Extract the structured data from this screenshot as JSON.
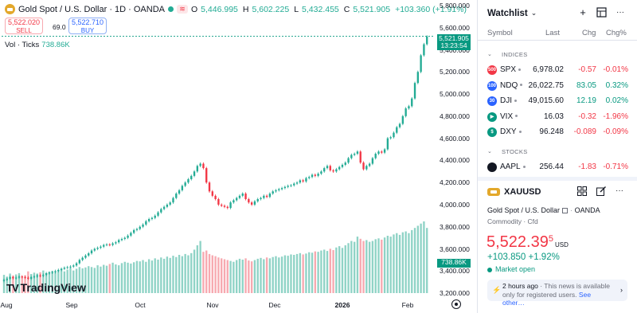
{
  "chart_header": {
    "title": "Gold Spot / U.S. Dollar · 1D · OANDA",
    "wave_glyph": "≋",
    "open_label": "O",
    "open": "5,446.995",
    "high_label": "H",
    "high": "5,602.225",
    "low_label": "L",
    "low": "5,432.455",
    "close_label": "C",
    "close": "5,521.905",
    "change": "+103.360 (+1.91%)"
  },
  "trade": {
    "sell_price": "5,522.020",
    "sell_label": "SELL",
    "spread": "69.0",
    "buy_price": "5,522.710",
    "buy_label": "BUY"
  },
  "volume_legend": {
    "label": "Vol · Ticks",
    "value": "738.86K"
  },
  "price_tag": {
    "price": "5,521.905",
    "countdown": "13:23:54"
  },
  "volume_tag": "738.86K",
  "brand": "TradingView",
  "y_ticks": [
    "5,800.000",
    "5,600.000",
    "5,400.000",
    "5,200.000",
    "5,000.000",
    "4,800.000",
    "4,600.000",
    "4,400.000",
    "4,200.000",
    "4,000.000",
    "3,800.000",
    "3,600.000",
    "3,400.000",
    "3,200.000"
  ],
  "x_ticks": [
    "Aug",
    "Sep",
    "Oct",
    "Nov",
    "Dec",
    "2026",
    "Feb"
  ],
  "colors": {
    "up": "#22ab94",
    "down": "#f23645",
    "vol_up": "#8fd3c6",
    "vol_down": "#f7a9b0",
    "accent": "#2962ff"
  },
  "chart_data": {
    "type": "candlestick",
    "title": "Gold Spot / U.S. Dollar",
    "ylim": [
      3150,
      5850
    ],
    "x_ticks": [
      "Aug",
      "Sep",
      "Oct",
      "Nov",
      "Dec",
      "2026",
      "Feb"
    ],
    "last_close": 5521.905,
    "volume_last": "738.86K",
    "candles_close": [
      3320,
      3330,
      3345,
      3335,
      3340,
      3350,
      3345,
      3340,
      3330,
      3345,
      3350,
      3360,
      3355,
      3365,
      3380,
      3385,
      3390,
      3400,
      3410,
      3420,
      3430,
      3435,
      3440,
      3450,
      3470,
      3500,
      3520,
      3540,
      3560,
      3585,
      3600,
      3610,
      3620,
      3635,
      3640,
      3635,
      3650,
      3660,
      3680,
      3690,
      3700,
      3720,
      3745,
      3770,
      3780,
      3800,
      3820,
      3850,
      3870,
      3880,
      3900,
      3930,
      3960,
      3980,
      4000,
      4020,
      4060,
      4100,
      4130,
      4170,
      4200,
      4230,
      4260,
      4300,
      4350,
      4370,
      4330,
      4200,
      4120,
      4080,
      4050,
      4000,
      3990,
      3980,
      3970,
      4020,
      4040,
      4060,
      4080,
      4100,
      4050,
      4020,
      4000,
      4030,
      4050,
      4060,
      4080,
      4070,
      4100,
      4120,
      4130,
      4140,
      4150,
      4160,
      4170,
      4175,
      4190,
      4200,
      4220,
      4210,
      4240,
      4250,
      4270,
      4260,
      4280,
      4300,
      4330,
      4350,
      4310,
      4300,
      4320,
      4340,
      4360,
      4380,
      4420,
      4450,
      4460,
      4480,
      4380,
      4320,
      4350,
      4370,
      4420,
      4460,
      4480,
      4470,
      4500,
      4600,
      4610,
      4650,
      4700,
      4730,
      4800,
      4870,
      4890,
      4960,
      5100,
      5200,
      5350,
      5450,
      5520
    ],
    "volume": [
      420,
      380,
      450,
      400,
      430,
      460,
      390,
      410,
      500,
      440,
      470,
      450,
      480,
      520,
      460,
      490,
      510,
      480,
      530,
      560,
      500,
      540,
      580,
      520,
      560,
      600,
      570,
      590,
      620,
      600,
      580,
      640,
      610,
      650,
      630,
      670,
      700,
      660,
      640,
      690,
      720,
      700,
      680,
      710,
      740,
      730,
      760,
      720,
      780,
      750,
      800,
      770,
      820,
      790,
      840,
      810,
      860,
      830,
      880,
      850,
      900,
      870,
      920,
      1000,
      1100,
      1200,
      950,
      980,
      900,
      870,
      850,
      820,
      800,
      780,
      760,
      740,
      720,
      760,
      790,
      770,
      800,
      750,
      730,
      760,
      790,
      810,
      780,
      820,
      800,
      830,
      850,
      820,
      840,
      870,
      860,
      890,
      880,
      900,
      920,
      890,
      910,
      940,
      930,
      960,
      950,
      980,
      1000,
      970,
      1020,
      990,
      1050,
      1080,
      1040,
      1100,
      1150,
      1200,
      1180,
      1300,
      1250,
      1200,
      1220,
      1180,
      1200,
      1240,
      1260,
      1230,
      1280,
      1320,
      1300,
      1350,
      1380,
      1340,
      1400,
      1420,
      1380,
      1450,
      1500,
      1550,
      1600,
      1650,
      1500
    ]
  },
  "watchlist": {
    "title": "Watchlist",
    "chevron": "⌄",
    "add_glyph": "+",
    "more_glyph": "···",
    "columns": {
      "symbol": "Symbol",
      "last": "Last",
      "chg": "Chg",
      "chg_pct": "Chg%"
    },
    "sections": {
      "indices": "INDICES",
      "stocks": "STOCKS"
    },
    "rows": [
      {
        "symbol": "SPX",
        "logo": "500",
        "logo_color": "#f23645",
        "last": "6,978.02",
        "chg": "-0.57",
        "chg_pct": "-0.01%",
        "dir": "down"
      },
      {
        "symbol": "NDQ",
        "logo": "100",
        "logo_color": "#2962ff",
        "last": "26,022.75",
        "chg": "83.05",
        "chg_pct": "0.32%",
        "dir": "up"
      },
      {
        "symbol": "DJI",
        "logo": "30",
        "logo_color": "#2962ff",
        "last": "49,015.60",
        "chg": "12.19",
        "chg_pct": "0.02%",
        "dir": "up"
      },
      {
        "symbol": "VIX",
        "logo": "▶",
        "logo_color": "#089981",
        "last": "16.03",
        "chg": "-0.32",
        "chg_pct": "-1.96%",
        "dir": "down"
      },
      {
        "symbol": "DXY",
        "logo": "$",
        "logo_color": "#089981",
        "last": "96.248",
        "chg": "-0.089",
        "chg_pct": "-0.09%",
        "dir": "down"
      },
      {
        "symbol": "AAPL",
        "logo": "",
        "logo_color": "#131722",
        "last": "256.44",
        "chg": "-1.83",
        "chg_pct": "-0.71%",
        "dir": "down"
      }
    ]
  },
  "detail": {
    "symbol": "XAUUSD",
    "name": "Gold Spot / U.S. Dollar",
    "exchange": "OANDA",
    "category": "Commodity · Cfd",
    "price_main": "5,522.39",
    "price_sup": "5",
    "currency": "USD",
    "change": "+103.850",
    "change_pct": "+1.92%",
    "market_status": "Market open",
    "news_time": "2 hours ago",
    "news_text": " · This news is available only for registered users.",
    "news_more": "See other…"
  }
}
